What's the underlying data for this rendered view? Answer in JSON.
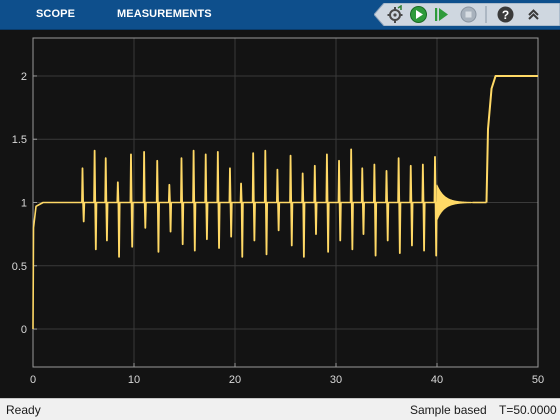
{
  "toolstrip": {
    "tabs": [
      {
        "label": "SCOPE"
      },
      {
        "label": "MEASUREMENTS"
      }
    ],
    "quick_access": [
      {
        "icon": "sampling-settings-icon"
      },
      {
        "icon": "run-icon"
      },
      {
        "icon": "step-forward-icon"
      },
      {
        "icon": "stop-icon"
      },
      {
        "icon": "help-icon"
      },
      {
        "icon": "expand-icon"
      }
    ]
  },
  "colors": {
    "toolstrip_bg": "#0e4f8c",
    "plot_bg": "#131313",
    "grid": "#3a3a3a",
    "axes_border": "#9a9a9a",
    "tick_label": "#d9d9d9",
    "signal": "#ffd966"
  },
  "status": {
    "ready": "Ready",
    "mode": "Sample based",
    "time": "T=50.0000"
  },
  "chart_data": {
    "type": "line",
    "grid": true,
    "xlim": [
      0,
      50
    ],
    "ylim": [
      -0.3,
      2.3
    ],
    "xticks": [
      0,
      10,
      20,
      30,
      40,
      50
    ],
    "yticks": [
      0,
      0.5,
      1,
      1.5,
      2
    ],
    "xtick_labels": [
      "0",
      "10",
      "20",
      "30",
      "40",
      "50"
    ],
    "ytick_labels": [
      "0",
      "0.5",
      "1",
      "1.5",
      "2"
    ],
    "series": [
      {
        "color": "#ffd966",
        "baseline_segments": [
          {
            "x": [
              0,
              0.05,
              0.3,
              1,
              40
            ],
            "y": [
              0,
              0.8,
              0.97,
              1.0,
              1.0
            ]
          }
        ],
        "spikes": [
          {
            "x": 4.9,
            "up": 1.27,
            "down": 0.85
          },
          {
            "x": 6.1,
            "up": 1.41,
            "down": 0.63
          },
          {
            "x": 7.2,
            "up": 1.35,
            "down": 0.7
          },
          {
            "x": 8.4,
            "up": 1.16,
            "down": 0.57
          },
          {
            "x": 9.7,
            "up": 1.38,
            "down": 0.65
          },
          {
            "x": 11.0,
            "up": 1.4,
            "down": 0.8
          },
          {
            "x": 12.3,
            "up": 1.33,
            "down": 0.61
          },
          {
            "x": 13.5,
            "up": 1.14,
            "down": 0.77
          },
          {
            "x": 14.7,
            "up": 1.35,
            "down": 0.67
          },
          {
            "x": 15.9,
            "up": 1.41,
            "down": 0.62
          },
          {
            "x": 17.1,
            "up": 1.38,
            "down": 0.71
          },
          {
            "x": 18.3,
            "up": 1.4,
            "down": 0.64
          },
          {
            "x": 19.5,
            "up": 1.27,
            "down": 0.73
          },
          {
            "x": 20.6,
            "up": 1.15,
            "down": 0.57
          },
          {
            "x": 21.8,
            "up": 1.39,
            "down": 0.7
          },
          {
            "x": 23.0,
            "up": 1.41,
            "down": 0.59
          },
          {
            "x": 24.2,
            "up": 1.26,
            "down": 0.78
          },
          {
            "x": 25.5,
            "up": 1.37,
            "down": 0.66
          },
          {
            "x": 26.7,
            "up": 1.23,
            "down": 0.57
          },
          {
            "x": 27.9,
            "up": 1.29,
            "down": 0.75
          },
          {
            "x": 29.1,
            "up": 1.38,
            "down": 0.61
          },
          {
            "x": 30.3,
            "up": 1.33,
            "down": 0.7
          },
          {
            "x": 31.5,
            "up": 1.42,
            "down": 0.63
          },
          {
            "x": 32.6,
            "up": 1.27,
            "down": 0.75
          },
          {
            "x": 33.8,
            "up": 1.3,
            "down": 0.58
          },
          {
            "x": 35.0,
            "up": 1.25,
            "down": 0.7
          },
          {
            "x": 36.2,
            "up": 1.35,
            "down": 0.6
          },
          {
            "x": 37.4,
            "up": 1.29,
            "down": 0.66
          },
          {
            "x": 38.6,
            "up": 1.3,
            "down": 0.62
          },
          {
            "x": 39.8,
            "up": 1.36,
            "down": 0.58
          }
        ],
        "decay": {
          "x_start": 40.0,
          "x_end": 43.5,
          "amplitude": 0.14,
          "center": 1.0
        },
        "flat_end": {
          "x_start": 43.5,
          "x_end": 44.9,
          "y": 1.0
        },
        "step": {
          "x": [
            44.9,
            45.05,
            45.4,
            45.8,
            47,
            50
          ],
          "y": [
            1.0,
            1.58,
            1.9,
            2.0,
            2.0,
            2.0
          ]
        }
      }
    ]
  }
}
